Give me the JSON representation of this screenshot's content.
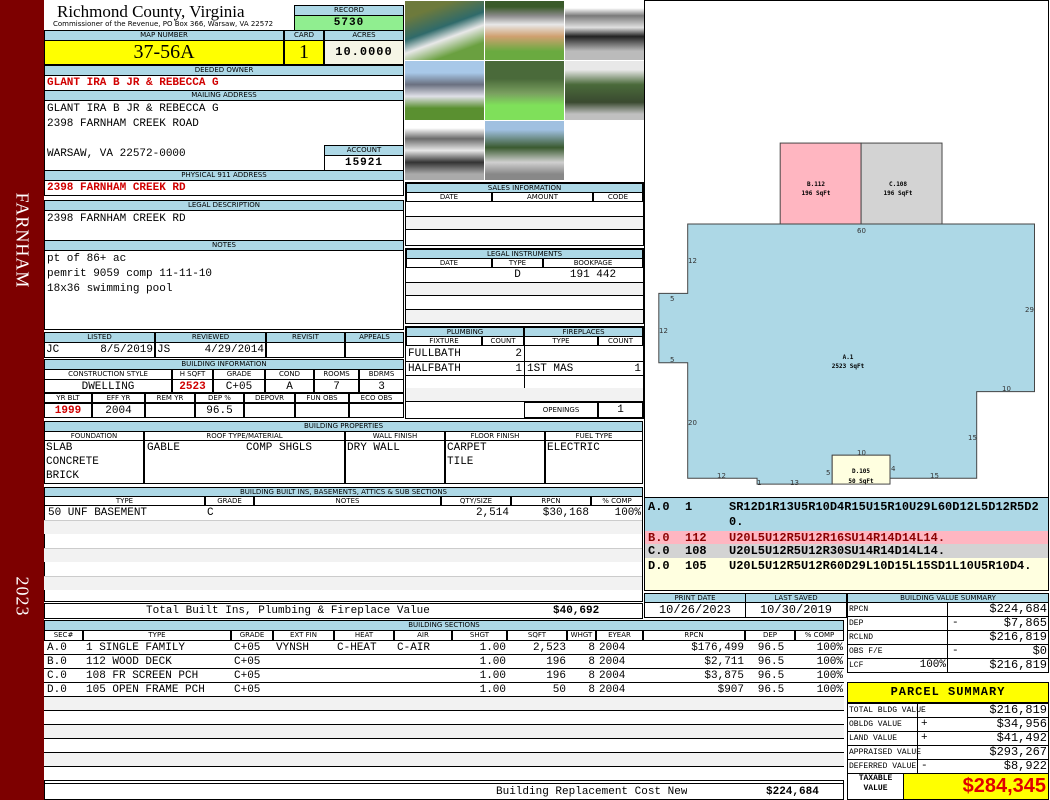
{
  "sidebar": {
    "district": "FARNHAM",
    "year": "2023"
  },
  "header": {
    "title": "Richmond County, Virginia",
    "subtitle": "Commissioner of the Revenue, PO Box 366, Warsaw, VA 22572"
  },
  "record": {
    "label": "RECORD",
    "value": "5730"
  },
  "map": {
    "label": "MAP NUMBER",
    "value": "37-56A",
    "card_label": "CARD",
    "card": "1",
    "acres_label": "ACRES",
    "acres": "10.0000"
  },
  "owner": {
    "label": "DEEDED OWNER",
    "value": "GLANT IRA B JR & REBECCA G"
  },
  "mailing": {
    "label": "MAILING ADDRESS",
    "line1": "GLANT IRA B JR & REBECCA G",
    "line2": "2398 FARNHAM CREEK ROAD",
    "line3": "WARSAW, VA 22572-0000"
  },
  "account": {
    "label": "ACCOUNT",
    "value": "15921"
  },
  "physical": {
    "label": "PHYSICAL 911 ADDRESS",
    "value": "2398 FARNHAM CREEK RD"
  },
  "legal": {
    "label": "LEGAL DESCRIPTION",
    "value": "2398 FARNHAM CREEK RD"
  },
  "notes": {
    "label": "NOTES",
    "lines": [
      "pt of 86+ ac",
      "pemrit 9059 comp 11-11-10",
      "18x36 swimming pool"
    ]
  },
  "listing": {
    "listed_label": "LISTED",
    "reviewed_label": "REVIEWED",
    "revisit_label": "REVISIT",
    "appeals_label": "APPEALS",
    "listed_by": "JC",
    "listed_date": "8/5/2019",
    "reviewed_by": "JS",
    "reviewed_date": "4/29/2014"
  },
  "building_info": {
    "label": "BUILDING INFORMATION",
    "h": [
      "CONSTRUCTION STYLE",
      "H SQFT",
      "GRADE",
      "COND",
      "ROOMS",
      "BDRMS"
    ],
    "v": [
      "DWELLING",
      "2523",
      "C+05",
      "A",
      "7",
      "3"
    ],
    "h2": [
      "YR BLT",
      "EFF YR",
      "REM YR",
      "DEP %",
      "DEPOVR",
      "FUN OBS",
      "ECO OBS"
    ],
    "v2": [
      "1999",
      "2004",
      "",
      "96.5",
      "",
      "",
      ""
    ]
  },
  "building_props": {
    "label": "BUILDING PROPERTIES",
    "h": [
      "FOUNDATION",
      "ROOF TYPE/MATERIAL",
      "WALL FINISH",
      "FLOOR FINISH",
      "FUEL TYPE"
    ],
    "foundation": [
      "SLAB",
      "CONCRETE",
      "BRICK"
    ],
    "roof_type": "GABLE",
    "roof_material": "COMP SHGLS",
    "wall": "DRY WALL",
    "floor": [
      "CARPET",
      "TILE"
    ],
    "fuel": "ELECTRIC"
  },
  "builtins": {
    "label": "BUILDING BUILT INS, BASEMENTS, ATTICS & SUB SECTIONS",
    "h": [
      "TYPE",
      "GRADE",
      "NOTES",
      "QTY/SIZE",
      "RPCN",
      "% COMP"
    ],
    "row": {
      "type": "50 UNF BASEMENT",
      "grade": "C",
      "notes": "",
      "qty": "2,514",
      "rpcn": "$30,168",
      "comp": "100%"
    },
    "total_label": "Total Built Ins, Plumbing & Fireplace Value",
    "total": "$40,692"
  },
  "sales": {
    "label": "SALES INFORMATION",
    "h": [
      "DATE",
      "AMOUNT",
      "CODE"
    ]
  },
  "instruments": {
    "label": "LEGAL INSTRUMENTS",
    "h": [
      "DATE",
      "TYPE",
      "BOOKPAGE"
    ],
    "row": {
      "date": "",
      "type": "D",
      "bookpage": "191 442"
    }
  },
  "plumbing": {
    "label": "PLUMBING",
    "h": [
      "FIXTURE",
      "COUNT"
    ],
    "rows": [
      {
        "f": "FULLBATH",
        "c": "2"
      },
      {
        "f": "HALFBATH",
        "c": "1"
      }
    ]
  },
  "fireplaces": {
    "label": "FIREPLACES",
    "h": [
      "TYPE",
      "COUNT"
    ],
    "rows": [
      {
        "t": "1ST MAS",
        "c": "1"
      }
    ],
    "openings_label": "OPENINGS",
    "openings": "1"
  },
  "sketch": {
    "labels": [
      {
        "id": "A.1",
        "area": "2523 SqFt"
      },
      {
        "id": "B.112",
        "area": "196 SqFt"
      },
      {
        "id": "C.108",
        "area": "196 SqFt"
      },
      {
        "id": "D.105",
        "area": "50 SqFt"
      }
    ],
    "dims": [
      "60",
      "12",
      "5",
      "12",
      "5",
      "20",
      "29",
      "10",
      "15",
      "10",
      "4",
      "15",
      "12",
      "1",
      "13",
      "5"
    ],
    "colors": {
      "a": "#add8e6",
      "b": "#ffb6c1",
      "c": "#d3d3d3",
      "d": "#ffffe0"
    },
    "legend": [
      {
        "sec": "A.0",
        "code": "1",
        "path": "SR12D1R13U5R10D4R15U15R10U29L60D12L5D12R5D20."
      },
      {
        "sec": "B.0",
        "code": "112",
        "path": "U20L5U12R5U12R16SU14R14D14L14."
      },
      {
        "sec": "C.0",
        "code": "108",
        "path": "U20L5U12R5U12R30SU14R14D14L14."
      },
      {
        "sec": "D.0",
        "code": "105",
        "path": "U20L5U12R5U12R60D29L10D15L15SD1L10U5R10D4."
      }
    ]
  },
  "dates": {
    "print_label": "PRINT DATE",
    "print": "10/26/2023",
    "saved_label": "LAST SAVED",
    "saved": "10/30/2019"
  },
  "sections": {
    "label": "BUILDING SECTIONS",
    "h": [
      "SEC#",
      "TYPE",
      "GRADE",
      "EXT FIN",
      "HEAT",
      "AIR",
      "SHGT",
      "SQFT",
      "WHGT",
      "EYEAR",
      "RPCN",
      "DEP",
      "% COMP"
    ],
    "rows": [
      [
        "A.0",
        "1 SINGLE FAMILY",
        "C+05",
        "VYNSH",
        "C-HEAT",
        "C-AIR",
        "1.00",
        "2,523",
        "8",
        "2004",
        "$176,499",
        "96.5",
        "100%"
      ],
      [
        "B.0",
        "112 WOOD DECK",
        "C+05",
        "",
        "",
        "",
        "1.00",
        "196",
        "8",
        "2004",
        "$2,711",
        "96.5",
        "100%"
      ],
      [
        "C.0",
        "108 FR SCREEN PCH",
        "C+05",
        "",
        "",
        "",
        "1.00",
        "196",
        "8",
        "2004",
        "$3,875",
        "96.5",
        "100%"
      ],
      [
        "D.0",
        "105 OPEN FRAME PCH",
        "C+05",
        "",
        "",
        "",
        "1.00",
        "50",
        "8",
        "2004",
        "$907",
        "96.5",
        "100%"
      ]
    ],
    "total_label": "Building Replacement Cost New",
    "total": "$224,684"
  },
  "value_summary": {
    "label": "BUILDING VALUE SUMMARY",
    "rows": [
      {
        "l": "RPCN",
        "s": "",
        "v": "$224,684"
      },
      {
        "l": "DEP",
        "s": "-",
        "v": "$7,865"
      },
      {
        "l": "RCLND",
        "s": "",
        "v": "$216,819"
      },
      {
        "l": "OBS F/E",
        "s": "-",
        "v": "$0"
      },
      {
        "l": "LCF",
        "s": "100%",
        "v": "$216,819"
      }
    ]
  },
  "parcel": {
    "label": "PARCEL SUMMARY",
    "rows": [
      {
        "l": "TOTAL BLDG VALUE",
        "s": "",
        "v": "$216,819"
      },
      {
        "l": "OBLDG VALUE",
        "s": "+",
        "v": "$34,956"
      },
      {
        "l": "LAND VALUE",
        "s": "+",
        "v": "$41,492"
      },
      {
        "l": "APPRAISED VALUE",
        "s": "",
        "v": "$293,267"
      },
      {
        "l": "DEFERRED VALUE",
        "s": "-",
        "v": "$8,922"
      }
    ],
    "taxable_label_1": "TAXABLE",
    "taxable_label_2": "VALUE",
    "taxable": "$284,345"
  }
}
